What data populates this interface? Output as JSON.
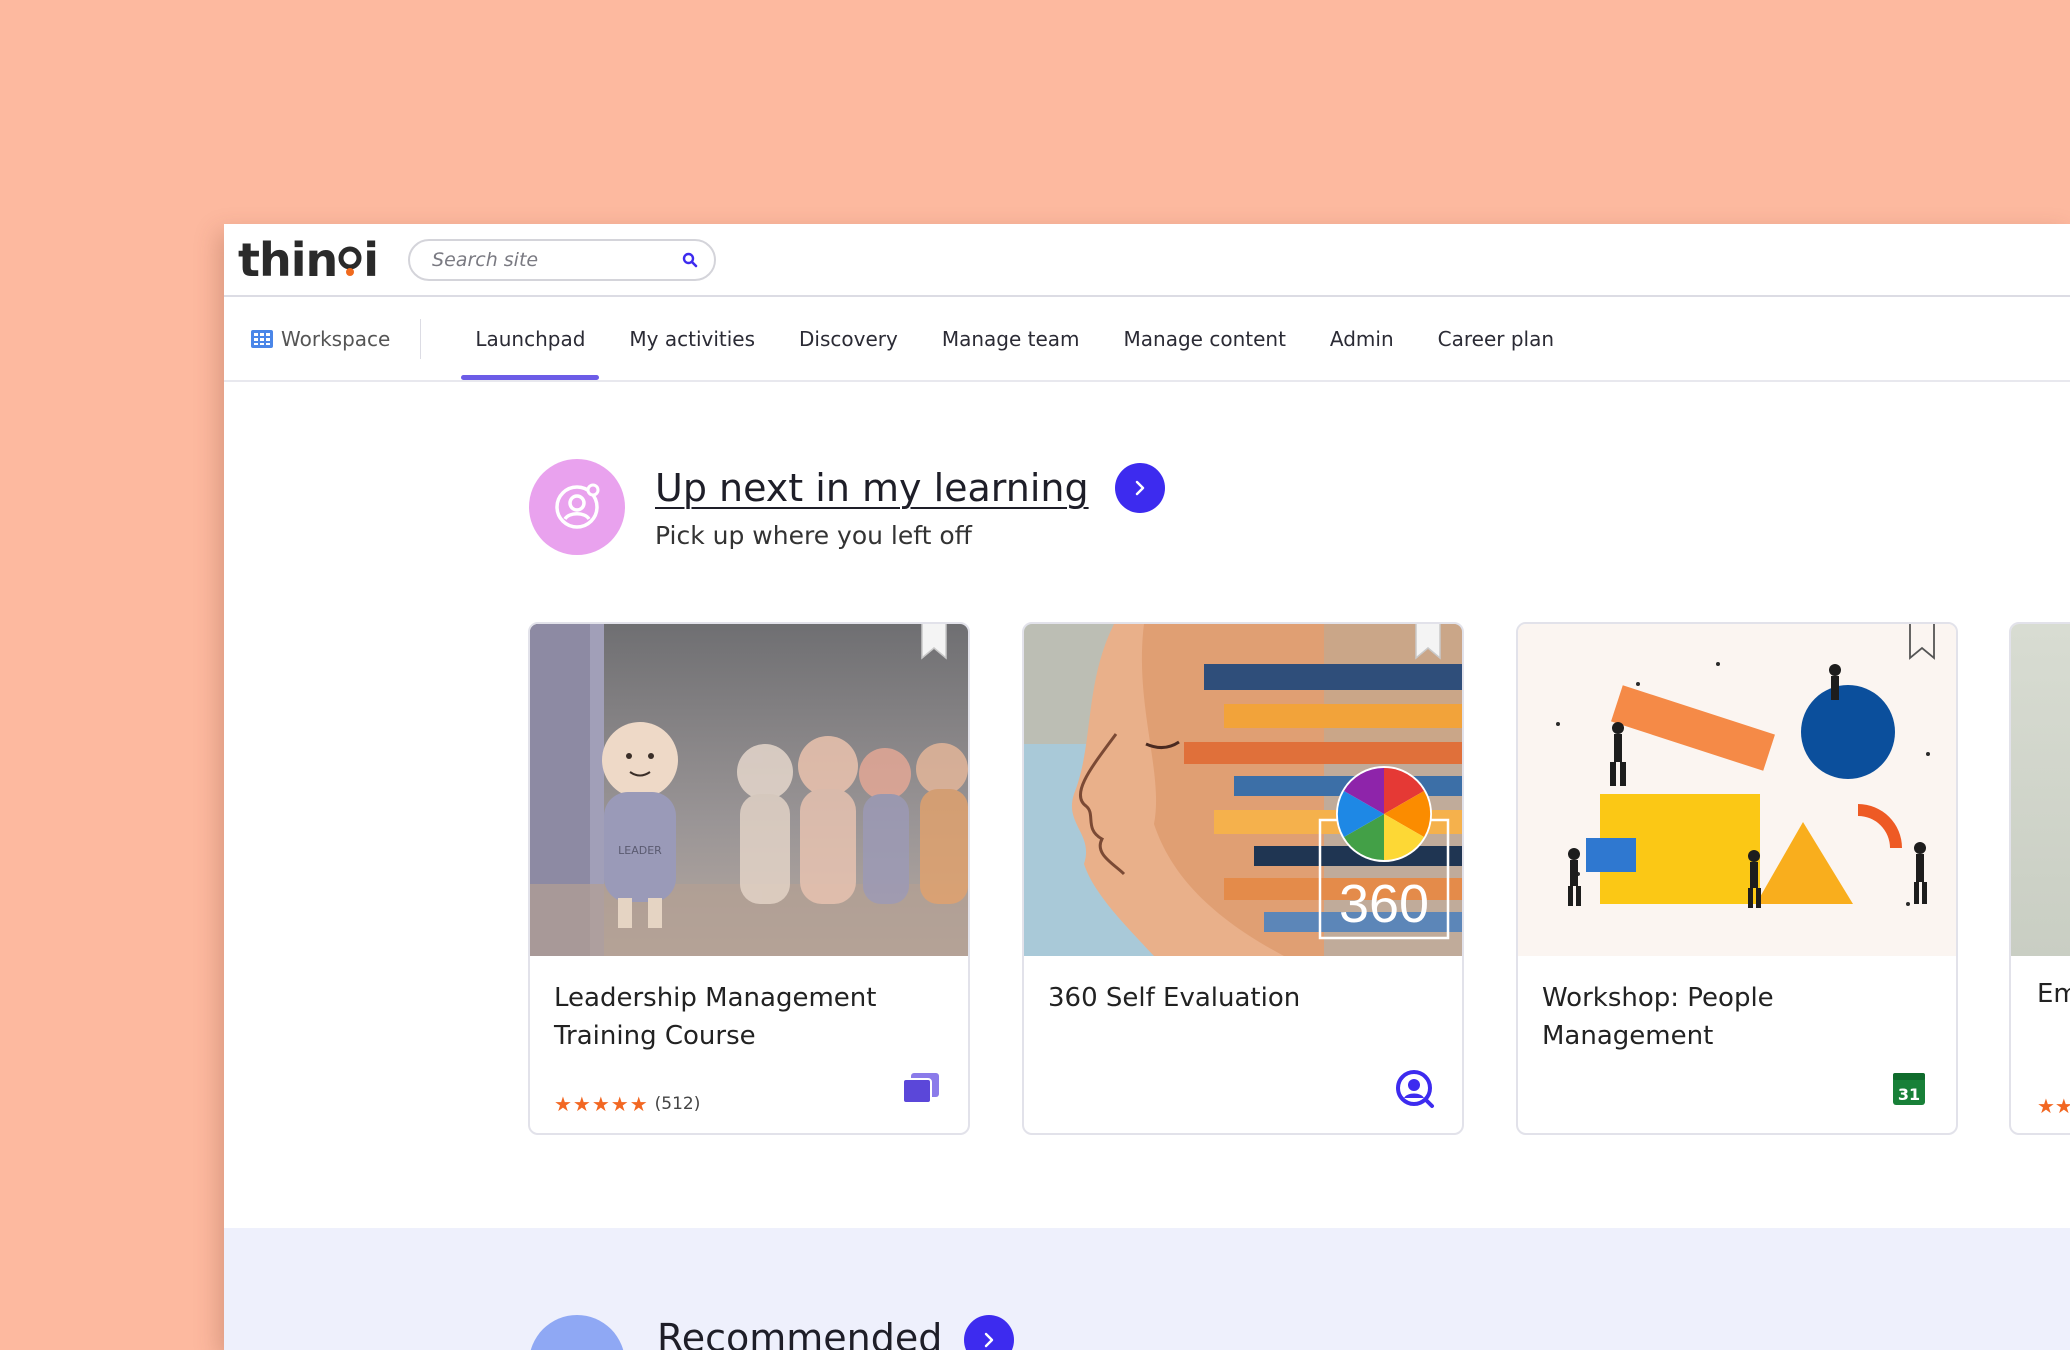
{
  "header": {
    "logo_text_left": "thin",
    "logo_text_right": "i",
    "search_placeholder": "Search site"
  },
  "nav": {
    "workspace_label": "Workspace",
    "tabs": [
      {
        "label": "Launchpad",
        "active": true
      },
      {
        "label": "My activities"
      },
      {
        "label": "Discovery"
      },
      {
        "label": "Manage team"
      },
      {
        "label": "Manage content"
      },
      {
        "label": "Admin"
      },
      {
        "label": "Career plan"
      }
    ],
    "accent_color": "#6C5CE7"
  },
  "up_next": {
    "title": "Up next in my learning",
    "subtitle": "Pick up where you left off",
    "cards": [
      {
        "title": "Leadership Management Training Course",
        "rating": 5,
        "rating_count": "(512)",
        "thumb_label": "LEADER",
        "type_icon": "course-stack-icon"
      },
      {
        "title": "360 Self Evaluation",
        "thumb_label": "360",
        "type_icon": "assessment-icon"
      },
      {
        "title": "Workshop: People Management",
        "type_icon": "calendar-icon",
        "calendar_day": "31"
      }
    ],
    "peek_card": {
      "title": "Em"
    }
  },
  "recommended": {
    "title": "Recommended"
  },
  "colors": {
    "background": "#FDB99F",
    "primary_button": "#3D2BEF",
    "rating_star": "#F26722"
  }
}
